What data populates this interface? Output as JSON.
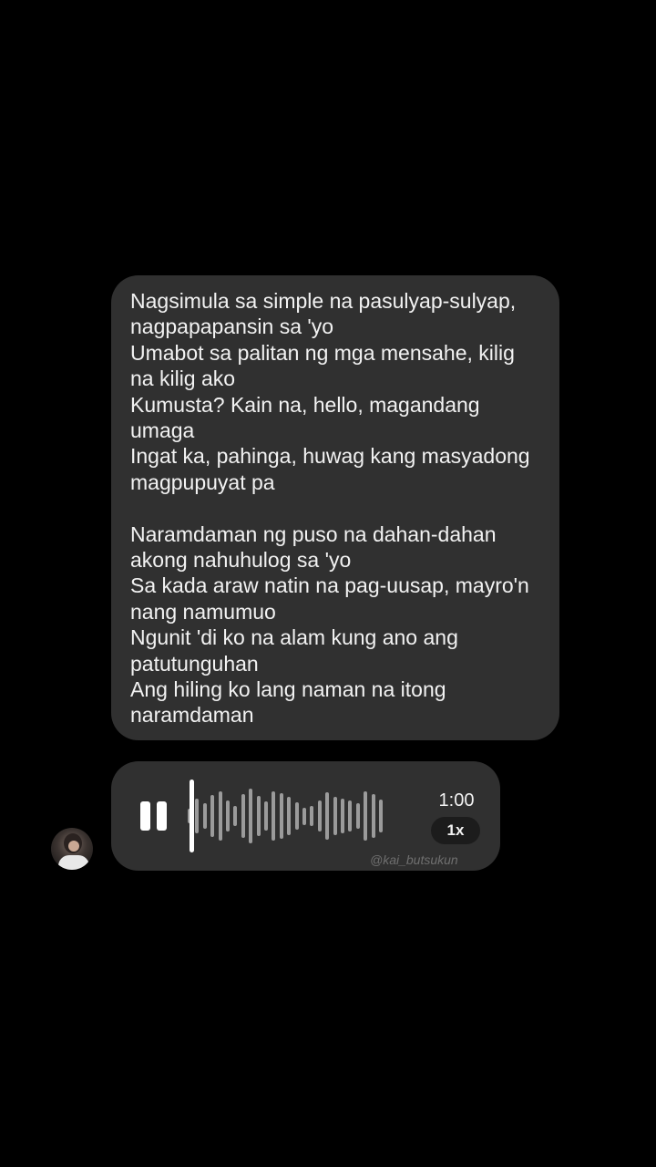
{
  "message": {
    "stanza1": [
      "Nagsimula sa simple na pasulyap-sulyap,",
      "nagpapapansin sa 'yo",
      "Umabot sa palitan ng mga mensahe, kilig",
      "na kilig ako",
      "Kumusta? Kain na, hello, magandang",
      "umaga",
      "Ingat ka, pahinga, huwag kang masyadong",
      "magpupuyat pa"
    ],
    "stanza2": [
      "Naramdaman ng puso na dahan-dahan",
      "akong nahuhulog sa 'yo",
      "Sa kada araw natin na pag-uusap, mayro'n",
      "nang namumuo",
      "Ngunit 'di ko na alam kung ano ang",
      "patutunguhan",
      "Ang hiling ko lang naman na itong",
      "naramdaman"
    ]
  },
  "voice_message": {
    "duration": "1:00",
    "speed_label": "1x",
    "pause_icon": "pause-icon",
    "waveform_levels": [
      0.22,
      0.5,
      0.38,
      0.6,
      0.7,
      0.45,
      0.3,
      0.62,
      0.8,
      0.58,
      0.42,
      0.72,
      0.66,
      0.55,
      0.4,
      0.25,
      0.3,
      0.45,
      0.68,
      0.55,
      0.5,
      0.45,
      0.38,
      0.7,
      0.62,
      0.48
    ]
  },
  "watermark": "@kai_butsukun",
  "colors": {
    "background": "#000000",
    "bubble": "#303030",
    "text": "#f2f2f2",
    "waveform": "#9b9b9b",
    "playhead": "#ffffff"
  }
}
